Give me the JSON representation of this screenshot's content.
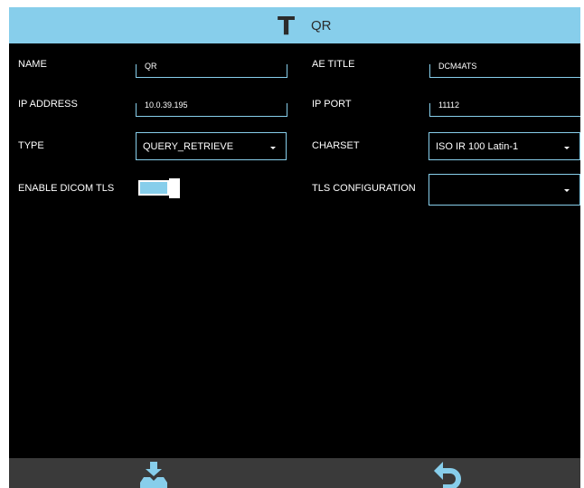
{
  "header": {
    "icon": "text-t-icon",
    "title": "QR"
  },
  "fields": {
    "name": {
      "label": "NAME",
      "value": "QR"
    },
    "ae_title": {
      "label": "AE TITLE",
      "value": "DCM4ATS"
    },
    "ip_address": {
      "label": "IP ADDRESS",
      "value": "10.0.39.195"
    },
    "ip_port": {
      "label": "IP PORT",
      "value": "11112"
    },
    "type": {
      "label": "TYPE",
      "value": "QUERY_RETRIEVE"
    },
    "charset": {
      "label": "CHARSET",
      "value": "ISO IR 100 Latin-1"
    },
    "enable_dicom_tls": {
      "label": "ENABLE DICOM TLS",
      "enabled": true
    },
    "tls_configuration": {
      "label": "TLS CONFIGURATION",
      "value": ""
    }
  },
  "footer": {
    "left_icon": "save-download-icon",
    "right_icon": "undo-arrow-icon"
  },
  "colors": {
    "accent": "#87ceeb",
    "background": "#000000",
    "footer": "#3a3a3a",
    "text": "#ffffff"
  }
}
